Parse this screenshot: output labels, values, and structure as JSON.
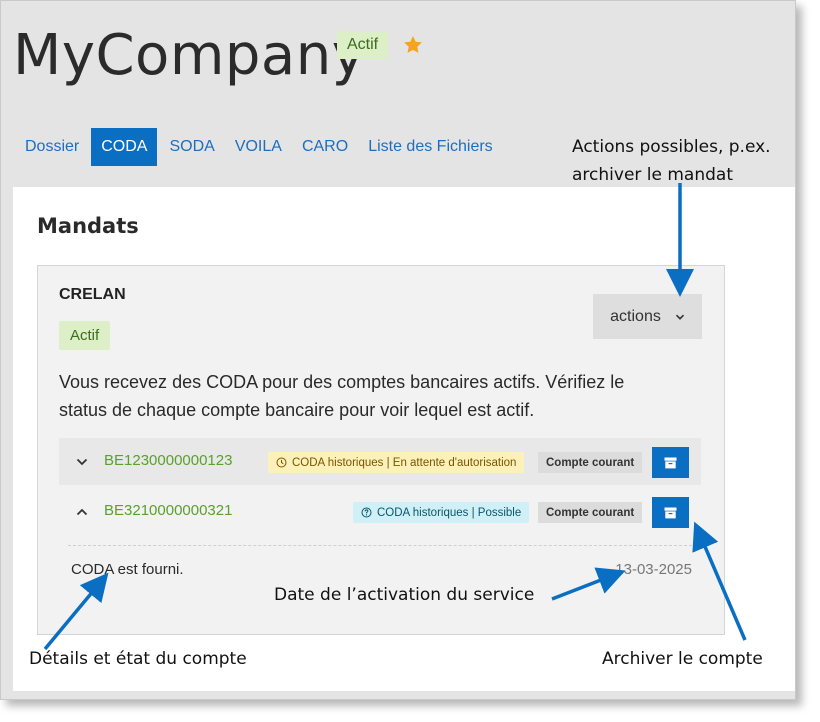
{
  "header": {
    "title": "MyCompany",
    "status": "Actif",
    "star_icon": "star-icon"
  },
  "tabs": [
    {
      "label": "Dossier",
      "active": false
    },
    {
      "label": "CODA",
      "active": true
    },
    {
      "label": "SODA",
      "active": false
    },
    {
      "label": "VOILA",
      "active": false
    },
    {
      "label": "CARO",
      "active": false
    },
    {
      "label": "Liste des Fichiers",
      "active": false
    }
  ],
  "main": {
    "section_title": "Mandats",
    "card": {
      "bank": "CRELAN",
      "status": "Actif",
      "actions_label": "actions",
      "description": "Vous recevez des CODA pour des comptes bancaires actifs. Vérifiez le status de chaque compte bancaire pour voir lequel est actif.",
      "accounts": [
        {
          "iban": "BE1230000000123",
          "coda_status": "CODA historiques | En attente d'autorisation",
          "coda_icon": "clock-icon",
          "account_type": "Compte courant",
          "expanded": false
        },
        {
          "iban": "BE3210000000321",
          "coda_status": "CODA historiques | Possible",
          "coda_icon": "question-circle-icon",
          "account_type": "Compte courant",
          "expanded": true,
          "detail_text": "CODA est fourni.",
          "detail_date": "13-03-2025"
        }
      ]
    }
  },
  "annotations": {
    "actions": "Actions possibles, p.ex. archiver le mandat",
    "actions_line1": "Actions possibles, p.ex.",
    "actions_line2": "archiver le mandat",
    "activation_date": "Date de l’activation du service",
    "account_details": "Détails et état du compte",
    "archive_account": "Archiver le compte"
  },
  "colors": {
    "accent": "#0a6fc2",
    "active_pill_bg": "#dcefc6",
    "iban_link": "#5aa02c",
    "pending_bg": "#fbf1b9",
    "possible_bg": "#cff0f7",
    "annotation_arrow": "#0a6fc2"
  }
}
